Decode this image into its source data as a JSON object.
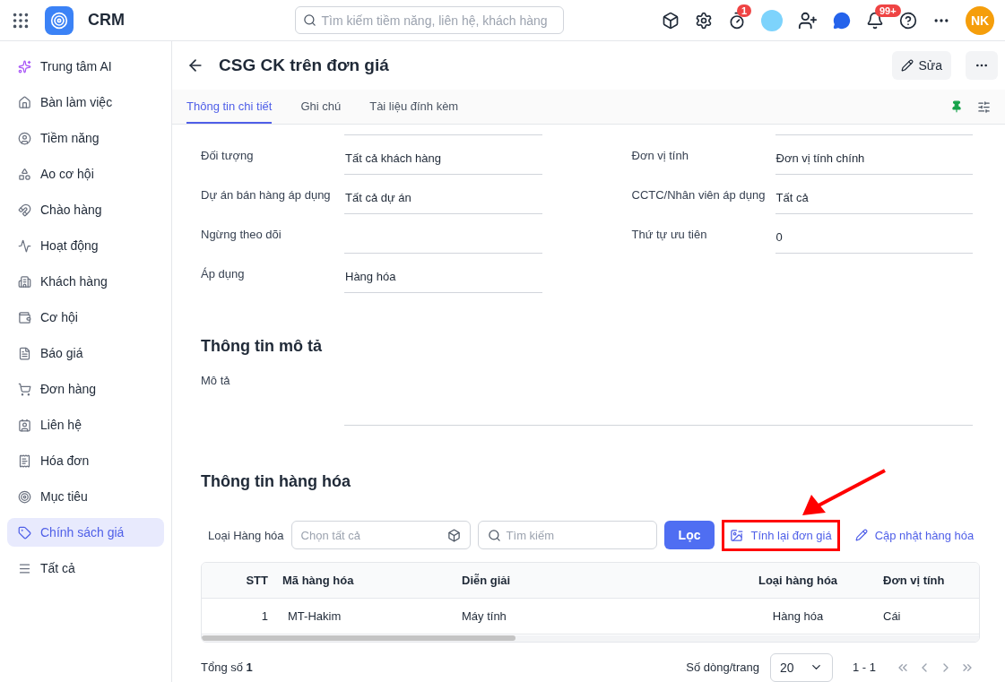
{
  "topbar": {
    "app_name": "CRM",
    "search": {
      "placeholder": "Tìm kiếm tiềm năng, liên hệ, khách hàng"
    },
    "timer_badge": "1",
    "notification_badge": "99+",
    "user_initials": "NK"
  },
  "sidebar": {
    "items": [
      {
        "label": "Trung tâm AI",
        "selected": false
      },
      {
        "label": "Bàn làm việc",
        "selected": false
      },
      {
        "label": "Tiềm năng",
        "selected": false
      },
      {
        "label": "Ao cơ hội",
        "selected": false
      },
      {
        "label": "Chào hàng",
        "selected": false
      },
      {
        "label": "Hoạt động",
        "selected": false
      },
      {
        "label": "Khách hàng",
        "selected": false
      },
      {
        "label": "Cơ hội",
        "selected": false
      },
      {
        "label": "Báo giá",
        "selected": false
      },
      {
        "label": "Đơn hàng",
        "selected": false
      },
      {
        "label": "Liên hệ",
        "selected": false
      },
      {
        "label": "Hóa đơn",
        "selected": false
      },
      {
        "label": "Mục tiêu",
        "selected": false
      },
      {
        "label": "Chính sách giá",
        "selected": true
      },
      {
        "label": "Tất cả",
        "selected": false
      }
    ]
  },
  "page": {
    "title": "CSG CK trên đơn giá",
    "edit_button": "Sửa"
  },
  "tabs": [
    {
      "label": "Thông tin chi tiết",
      "selected": true
    },
    {
      "label": "Ghi chú",
      "selected": false
    },
    {
      "label": "Tài liệu đính kèm",
      "selected": false
    }
  ],
  "fields": [
    {
      "label": "Đối tượng",
      "value": "Tất cả khách hàng"
    },
    {
      "label": "Đơn vị tính",
      "value": "Đơn vị tính chính"
    },
    {
      "label": "Dự án bán hàng áp dụng",
      "value": "Tất cả dự án"
    },
    {
      "label": "CCTC/Nhân viên áp dụng",
      "value": "Tất cả"
    },
    {
      "label": "Ngừng theo dõi"
    },
    {
      "label": "Thứ tự ưu tiên",
      "value": "0"
    },
    {
      "label": "Áp dụng",
      "value": "Hàng hóa"
    }
  ],
  "description_section": {
    "title": "Thông tin mô tả",
    "label": "Mô tả"
  },
  "goods_section": {
    "title": "Thông tin hàng hóa",
    "type_label": "Loại Hàng hóa",
    "type_placeholder": "Chọn tất cả",
    "search_placeholder": "Tìm kiếm",
    "filter_button": "Lọc",
    "actions": [
      {
        "label": "Tính lại đơn giá",
        "highlighted": true
      },
      {
        "label": "Cập nhật hàng hóa",
        "highlighted": false
      }
    ],
    "table": {
      "columns": [
        "STT",
        "Mã hàng hóa",
        "Diễn giải",
        "Loại hàng hóa",
        "Đơn vị tính"
      ],
      "rows": [
        [
          "1",
          "MT-Hakim",
          "Máy tính",
          "Hàng hóa",
          "Cái"
        ]
      ]
    },
    "total_label": "Tổng số",
    "total_value": "1",
    "page_size_label": "Số dòng/trang",
    "page_size": "20",
    "range": "1 - 1"
  }
}
